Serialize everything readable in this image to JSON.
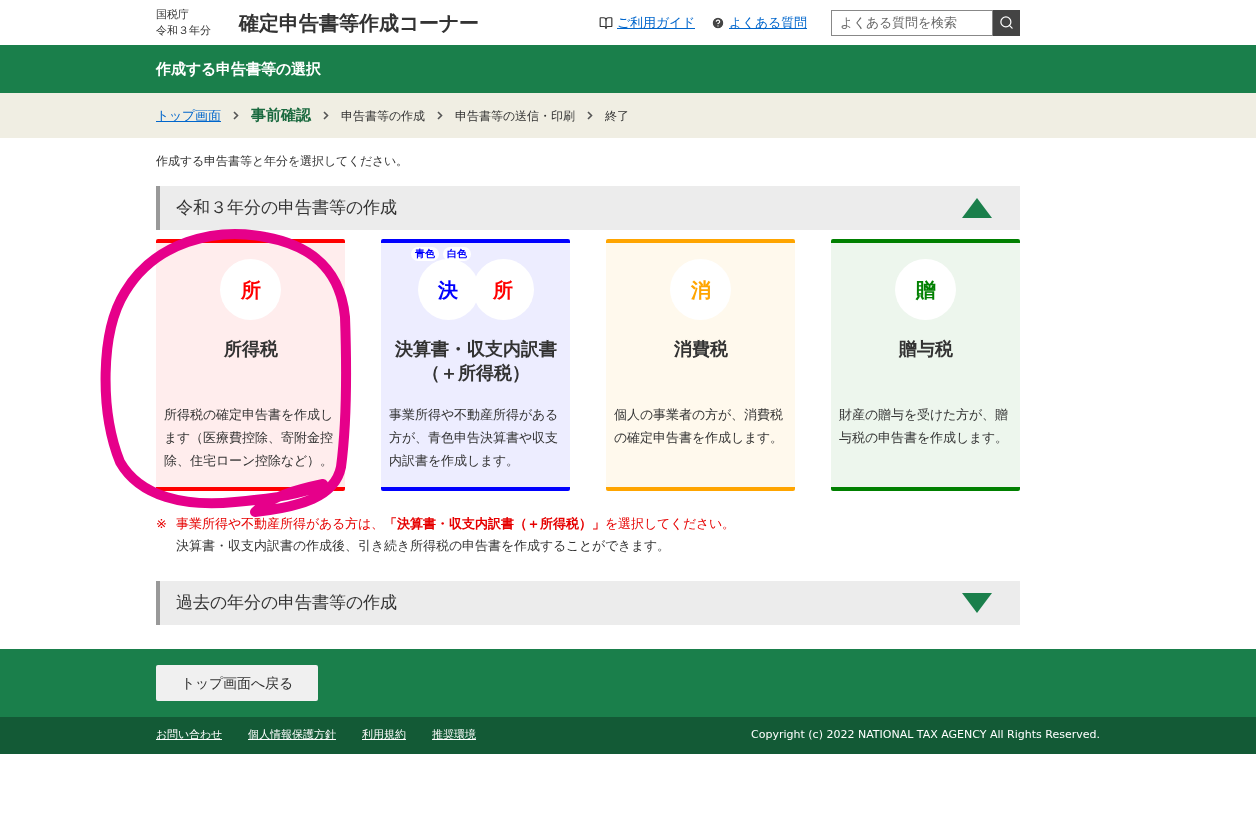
{
  "header": {
    "agency": "国税庁",
    "year": "令和３年分",
    "title": "確定申告書等作成コーナー",
    "links": [
      {
        "kind": "guide",
        "label": "ご利用ガイド"
      },
      {
        "kind": "faq",
        "label": "よくある質問"
      }
    ],
    "search": {
      "placeholder": "よくある質問を検索"
    }
  },
  "page_title": "作成する申告書等の選択",
  "breadcrumb": [
    {
      "label": "トップ画面",
      "kind": "link"
    },
    {
      "label": "事前確認",
      "kind": "current"
    },
    {
      "label": "申告書等の作成",
      "kind": "step"
    },
    {
      "label": "申告書等の送信・印刷",
      "kind": "step"
    },
    {
      "label": "終了",
      "kind": "step"
    }
  ],
  "intro": "作成する申告書等と年分を選択してください。",
  "sections": [
    {
      "title": "令和３年分の申告書等の作成",
      "expanded": true,
      "cards": [
        {
          "color": "#ff0000",
          "icons": [
            {
              "char": "所",
              "color": "#ff0000"
            }
          ],
          "title": "所得税",
          "description": "所得税の確定申告書を作成します（医療費控除、寄附金控除、住宅ローン控除など）。"
        },
        {
          "color": "#0000ff",
          "tags": [
            "青色",
            "白色"
          ],
          "icons": [
            {
              "char": "決",
              "color": "#0000ff"
            },
            {
              "char": "所",
              "color": "#ff0000"
            }
          ],
          "title": "決算書・収支内訳書（＋所得税）",
          "description": "事業所得や不動産所得がある方が、青色申告決算書や収支内訳書を作成します。"
        },
        {
          "color": "#ffa500",
          "icons": [
            {
              "char": "消",
              "color": "#ffa500"
            }
          ],
          "title": "消費税",
          "description": "個人の事業者の方が、消費税の確定申告書を作成します。"
        },
        {
          "color": "#008000",
          "icons": [
            {
              "char": "贈",
              "color": "#008000"
            }
          ],
          "title": "贈与税",
          "description": "財産の贈与を受けた方が、贈与税の申告書を作成します。"
        }
      ],
      "note": {
        "mark": "※",
        "warning": "事業所得や不動産所得がある方は、**「決算書・収支内訳書（＋所得税）」**を選択してください。",
        "detail": "決算書・収支内訳書の作成後、引き続き所得税の申告書を作成することができます。"
      }
    },
    {
      "title": "過去の年分の申告書等の作成",
      "expanded": false
    }
  ],
  "back_button": "トップ画面へ戻る",
  "footer": {
    "links": [
      "お問い合わせ",
      "個人情報保護方針",
      "利用規約",
      "推奨環境"
    ],
    "copyright": "Copyright (c) 2022 NATIONAL TAX AGENCY All Rights Reserved."
  }
}
